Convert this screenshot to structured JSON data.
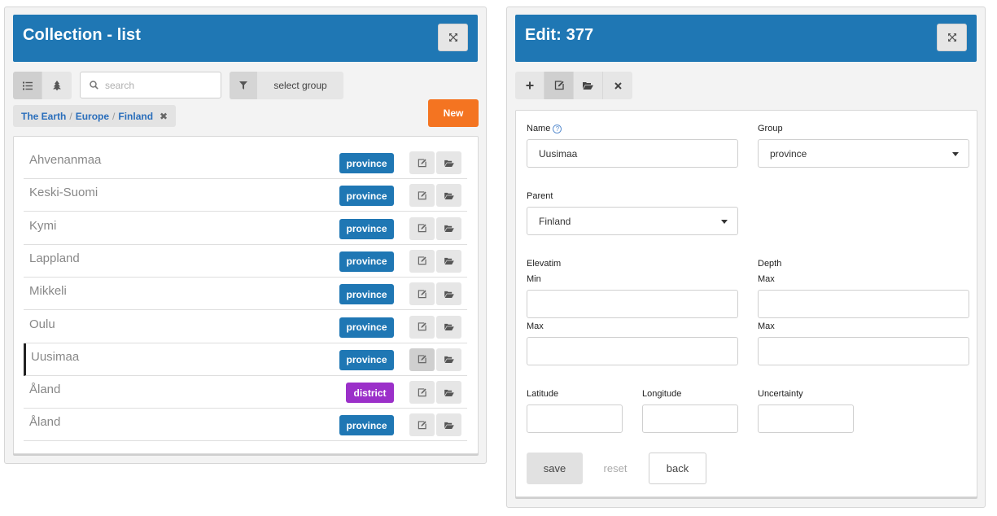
{
  "list_panel": {
    "title": "Collection - list",
    "expand_icon": "expand-arrows-icon",
    "view_modes": [
      {
        "name": "list-view",
        "icon": "list-icon",
        "active": true
      },
      {
        "name": "tree-view",
        "icon": "tree-icon",
        "active": false
      }
    ],
    "search": {
      "placeholder": "search",
      "value": ""
    },
    "group_filter": {
      "icon": "filter-icon",
      "label": "select group"
    },
    "breadcrumb": {
      "crumbs": [
        "The Earth",
        "Europe",
        "Finland"
      ],
      "separator": "/",
      "clear_label": "✖"
    },
    "new_label": "New",
    "rows": [
      {
        "name": "Ahvenanmaa",
        "group": "province",
        "selected": false
      },
      {
        "name": "Keski-Suomi",
        "group": "province",
        "selected": false
      },
      {
        "name": "Kymi",
        "group": "province",
        "selected": false
      },
      {
        "name": "Lappland",
        "group": "province",
        "selected": false
      },
      {
        "name": "Mikkeli",
        "group": "province",
        "selected": false
      },
      {
        "name": "Oulu",
        "group": "province",
        "selected": false
      },
      {
        "name": "Uusimaa",
        "group": "province",
        "selected": true
      },
      {
        "name": "Åland",
        "group": "district",
        "selected": false
      },
      {
        "name": "Åland",
        "group": "province",
        "selected": false
      }
    ]
  },
  "edit_panel": {
    "title": "Edit: 377",
    "expand_icon": "expand-arrows-icon",
    "toolbar": [
      {
        "name": "add",
        "icon": "plus-icon",
        "active": false
      },
      {
        "name": "edit",
        "icon": "edit-icon",
        "active": true
      },
      {
        "name": "open",
        "icon": "folder-open-icon",
        "active": false
      },
      {
        "name": "close",
        "icon": "close-icon",
        "active": false
      }
    ],
    "form": {
      "name_label": "Name",
      "name_help": "?",
      "name_value": "Uusimaa",
      "group_label": "Group",
      "group_value": "province",
      "parent_label": "Parent",
      "parent_value": "Finland",
      "elevation_label": "Elevatim",
      "depth_label": "Depth",
      "elev_min_label": "Min",
      "elev_max_label": "Max",
      "depth_min_label": "Max",
      "depth_max_label": "Max",
      "elev_min_value": "",
      "elev_max_value": "",
      "depth_min_value": "",
      "depth_max_value": "",
      "latitude_label": "Latitude",
      "longitude_label": "Longitude",
      "uncertainty_label": "Uncertainty",
      "latitude_value": "",
      "longitude_value": "",
      "uncertainty_value": ""
    },
    "actions": {
      "save": "save",
      "reset": "reset",
      "back": "back"
    }
  },
  "colors": {
    "header_blue": "#1f77b4",
    "province_badge": "#1f77b4",
    "district_badge": "#9b30c9",
    "new_button": "#f47421",
    "link_blue": "#2a6ebb"
  }
}
